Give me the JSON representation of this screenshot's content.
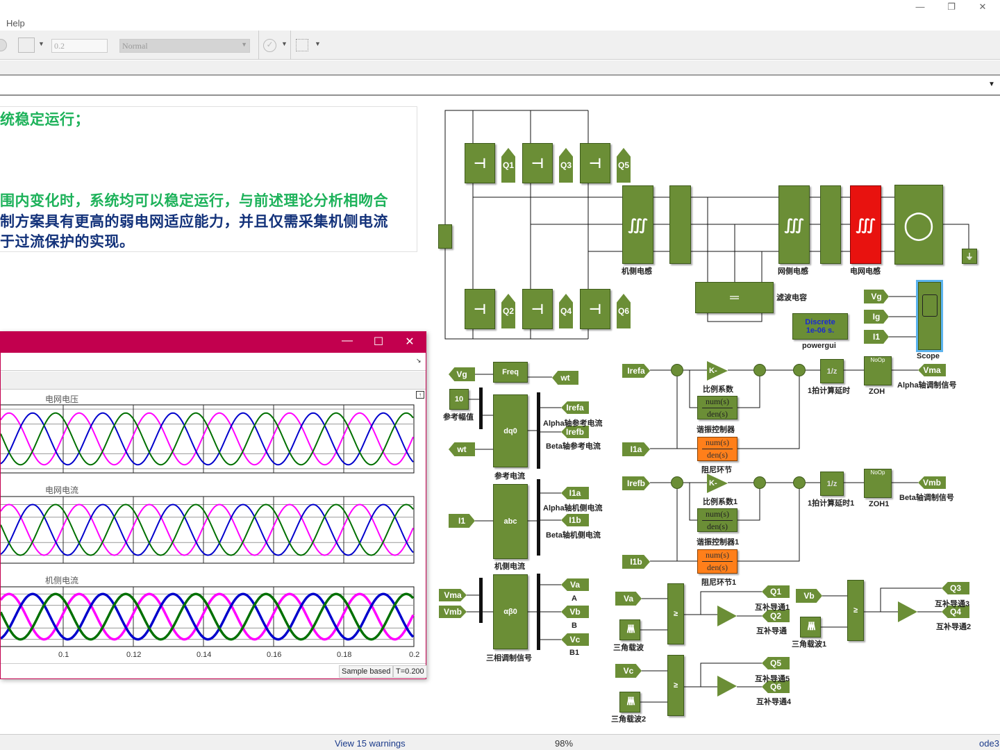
{
  "window": {
    "minimize_icon": "minimize-icon",
    "maximize_icon": "restore-icon",
    "close_icon": "close-icon"
  },
  "menu": {
    "help": "Help"
  },
  "toolbar": {
    "stop_time": "0.2",
    "sim_mode": "Normal"
  },
  "annotation": {
    "line1": "统稳定运行；",
    "line2": "围内变化时，系统均可以稳定运行，与前述理论分析相吻合",
    "line3": "制方案具有更高的弱电网适应能力，并且仅需采集机侧电流",
    "line4": "于过流保护的实现。",
    "colors": {
      "green": "#1db25a",
      "blue": "#13327a"
    }
  },
  "scope": {
    "title_color": "#c2004e",
    "panels": [
      "电网电压",
      "电网电流",
      "机侧电流"
    ],
    "x_ticks": [
      "0.1",
      "0.12",
      "0.14",
      "0.16",
      "0.18",
      "0.2"
    ],
    "sample_mode": "Sample based",
    "time": "T=0.200",
    "series_colors": [
      "#ff00ff",
      "#0000cc",
      "#007000"
    ]
  },
  "chart_data": {
    "type": "line",
    "x_ticks": [
      0.1,
      0.12,
      0.14,
      0.16,
      0.18,
      0.2
    ],
    "xlim": [
      0.082,
      0.2
    ],
    "panels": [
      "电网电压",
      "电网电流",
      "机侧电流"
    ],
    "series_count": 3,
    "frequency_hz": 50,
    "grid": true
  },
  "diagram": {
    "labels": {
      "machine_inductor": "机侧电感",
      "grid_side_inductor": "网侧电感",
      "grid_inductor": "电网电感",
      "filter_cap": "滤波电容",
      "powergui": "powergui",
      "powergui_text1": "Discrete",
      "powergui_text2": "1e-06 s.",
      "scope": "Scope",
      "ref_amp": "参考幅值",
      "ref_current": "参考电流",
      "alpha_ref": "Alpha轴参考电流",
      "beta_ref": "Beta轴参考电流",
      "machine_current": "机侧电流",
      "alpha_i1": "Alpha轴机侧电流",
      "beta_i1": "Beta轴机侧电流",
      "three_phase_mod": "三相调制信号",
      "A": "A",
      "B": "B",
      "B1": "B1",
      "gain": "比例系数",
      "gain1": "比例系数1",
      "resonant": "谐振控制器",
      "resonant1": "谐振控制器1",
      "damping": "阻尼环节",
      "damping1": "阻尼环节1",
      "delay": "1拍计算延时",
      "delay1": "1拍计算延时1",
      "zoh": "ZOH",
      "zoh1": "ZOH1",
      "alpha_mod": "Alpha轴调制信号",
      "beta_mod": "Beta轴调制信号",
      "comp1": "互补导通1",
      "comp": "互补导通",
      "comp3": "互补导通3",
      "comp2": "互补导通2",
      "comp5": "互补导通5",
      "comp4": "互补导通4",
      "carrier": "三角载波",
      "carrier1": "三角载波1",
      "carrier2": "三角载波2"
    },
    "tags": {
      "Q1": "Q1",
      "Q2": "Q2",
      "Q3": "Q3",
      "Q4": "Q4",
      "Q5": "Q5",
      "Q6": "Q6",
      "Vg": "Vg",
      "Ig": "Ig",
      "I1": "I1",
      "wt": "wt",
      "Irefa": "Irefa",
      "Irefb": "Irefb",
      "I1a": "I1a",
      "I1b": "I1b",
      "Vma": "Vma",
      "Vmb": "Vmb",
      "Va": "Va",
      "Vb": "Vb",
      "Vc": "Vc"
    },
    "blocks": {
      "const10": "10",
      "gain": "K-",
      "num": "num(s)",
      "den": "den(s)",
      "delay": "1/z",
      "zoh": "NoOp",
      "ge": "≥",
      "dq0": "dq0",
      "ab0": "αβ0",
      "abc": "abc",
      "freq": "Freq"
    }
  },
  "status": {
    "warnings": "View 15 warnings",
    "zoom": "98%",
    "solver": "ode3"
  }
}
